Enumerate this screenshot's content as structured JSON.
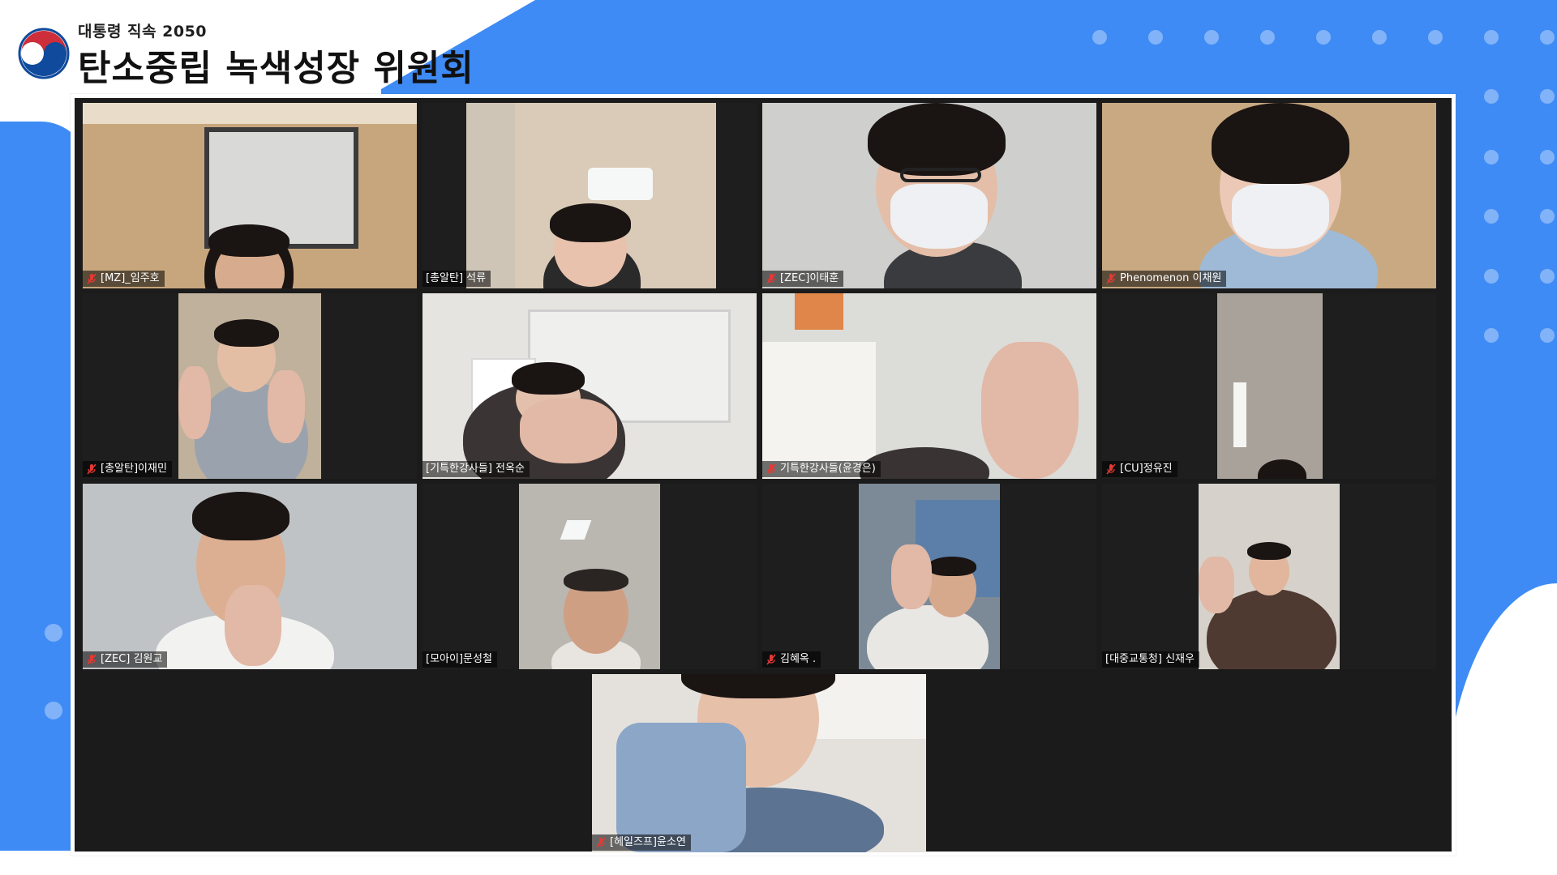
{
  "header": {
    "subtitle": "대통령 직속 2050",
    "title": "탄소중립 녹색성장 위원회"
  },
  "colors": {
    "background_blue": "#3f8bf5",
    "tile_background": "#1e1e1e",
    "muted_mic": "#e53935"
  },
  "participants": [
    {
      "name": "[MZ]_임주호",
      "muted": true
    },
    {
      "name": "[총알탄] 석류",
      "muted": false
    },
    {
      "name": "[ZEC]이태훈",
      "muted": true
    },
    {
      "name": "Phenomenon 이채원",
      "muted": true
    },
    {
      "name": "[총알탄]이재민",
      "muted": true
    },
    {
      "name": "[기특한강사들] 전옥순",
      "muted": false
    },
    {
      "name": "기특한강사들(윤경은)",
      "muted": true
    },
    {
      "name": "[CU]정유진",
      "muted": true
    },
    {
      "name": "[ZEC] 김원교",
      "muted": true
    },
    {
      "name": "[모아이]문성철",
      "muted": false
    },
    {
      "name": "김혜옥 .",
      "muted": true
    },
    {
      "name": "[대중교통청] 신재우",
      "muted": false
    },
    {
      "name": "[헤일즈프]윤소연",
      "muted": true
    }
  ]
}
